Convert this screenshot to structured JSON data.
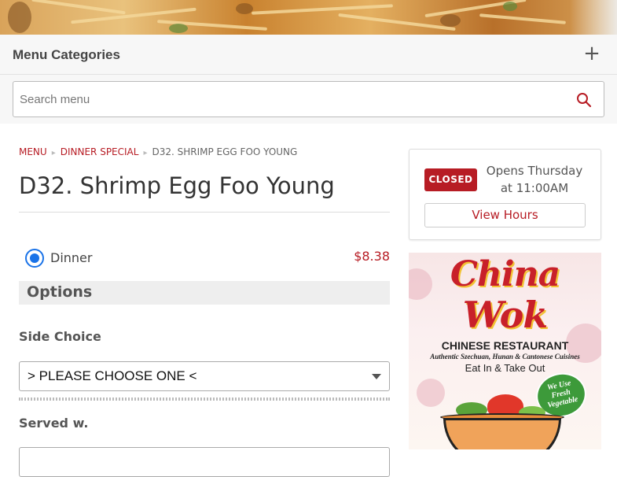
{
  "menu_categories": {
    "title": "Menu Categories",
    "expand_icon": "plus-icon"
  },
  "search": {
    "placeholder": "Search menu",
    "icon": "search-icon"
  },
  "breadcrumb": {
    "menu": "Menu",
    "category": "Dinner Special",
    "current": "D32. Shrimp Egg Foo Young"
  },
  "item": {
    "title": "D32. Shrimp Egg Foo Young"
  },
  "sizes": [
    {
      "label": "Dinner",
      "price": "$8.38",
      "selected": true
    }
  ],
  "options": {
    "title": "Options",
    "side_choice": {
      "label": "Side Choice",
      "value": "> PLEASE CHOOSE ONE <"
    },
    "served_with": {
      "label": "Served w."
    }
  },
  "hours": {
    "status": "CLOSED",
    "opens_line1": "Opens Thursday",
    "opens_line2": "at 11:00AM",
    "view_hours": "View Hours"
  },
  "promo": {
    "name_line1": "China",
    "name_line2": "Wok",
    "subtitle": "CHINESE RESTAURANT",
    "tagline": "Authentic Szechuan, Hunan & Cantonese Cuisines",
    "service": "Eat In & Take Out",
    "badge_line1": "We Use",
    "badge_line2": "Fresh",
    "badge_line3": "Vegetable"
  },
  "colors": {
    "accent": "#b71c24",
    "radio": "#1a73e8"
  }
}
